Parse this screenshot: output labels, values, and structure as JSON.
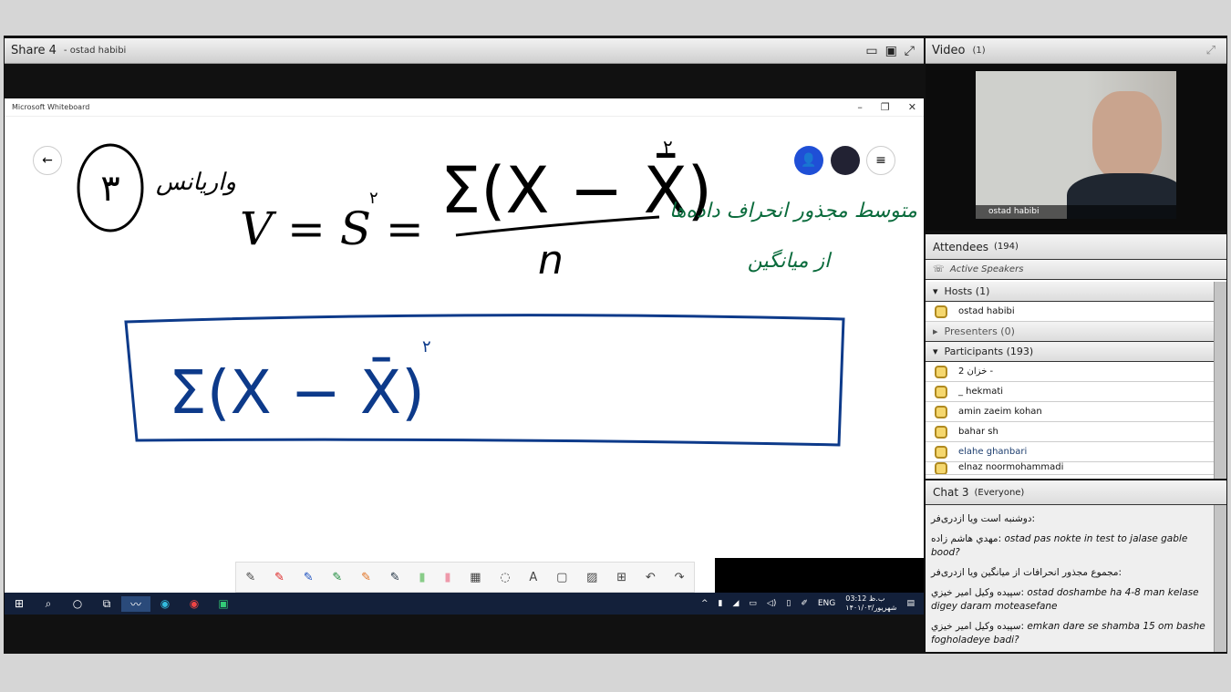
{
  "share": {
    "title": "Share 4",
    "presenter": "- ostad habibi"
  },
  "whiteboard": {
    "title": "Microsoft Whiteboard",
    "number_label": "٣",
    "word": "واریانس",
    "formula": "V = S² = Σ(X − X̄)² / n",
    "numerator": "Σ(X − X̄)",
    "exp": "٢",
    "denominator": "n",
    "note_line1": "متوسط مجذور انحراف داده‌ها",
    "note_line2": "از میانگین",
    "boxed": "Σ(X − X̄)"
  },
  "taskbar": {
    "lang": "ENG",
    "time": "03:12 ب.ظ",
    "date": "۱۴۰۱/شهریور/۰۳"
  },
  "video": {
    "title": "Video",
    "count": "(1)",
    "name": "ostad habibi"
  },
  "attendees": {
    "title": "Attendees",
    "count": "(194)",
    "active_speakers": "Active Speakers",
    "hosts": "Hosts (1)",
    "host_names": [
      "ostad habibi"
    ],
    "presenters": "Presenters (0)",
    "participants": "Participants (193)",
    "participant_names": [
      "خزان 2 -",
      "_ hekmati",
      "amin zaeim kohan",
      "bahar sh",
      "elahe ghanbari",
      "elnaz noormohammadi"
    ]
  },
  "chat": {
    "title": "Chat 3",
    "scope": "(Everyone)",
    "messages": [
      {
        "sender": "ویا ازدری‌فر:",
        "text": "دوشنبه است"
      },
      {
        "sender": "مهدي هاشم زاده:",
        "text": "ostad pas nokte in test to jalase gable bood?"
      },
      {
        "sender": "ویا ازدری‌فر:",
        "text": "مجموع مجذور انحرافات از میانگین"
      },
      {
        "sender": "سپیده وکیل امیر خیزي:",
        "text": "ostad doshambe ha 4-8 man kelase digey daram moteasefane"
      },
      {
        "sender": "سپیده وکیل امیر خیزي:",
        "text": "emkan dare se shamba 15 om bashe fogholadeye badi?"
      }
    ]
  }
}
